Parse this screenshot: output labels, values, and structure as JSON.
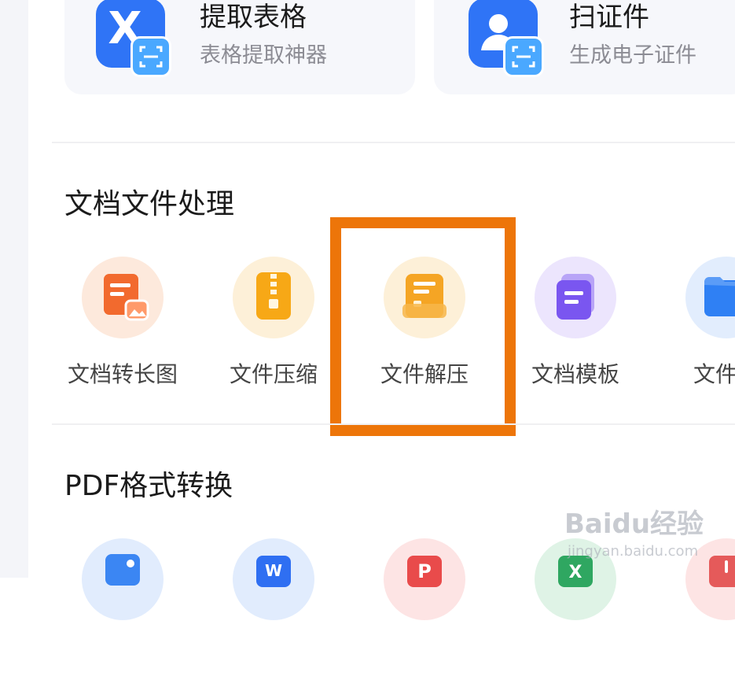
{
  "top_cards": [
    {
      "title": "提取表格",
      "subtitle": "表格提取神器",
      "icon": "table-extract-icon",
      "glyph": "X"
    },
    {
      "title": "扫证件",
      "subtitle": "生成电子证件",
      "icon": "id-card-scan-icon"
    }
  ],
  "sections": [
    {
      "title": "文档文件处理",
      "tools": [
        {
          "label": "文档转长图",
          "icon": "doc-to-long-image-icon",
          "color": "#f26a2e"
        },
        {
          "label": "文件压缩",
          "icon": "zip-compress-icon",
          "color": "#f7a816"
        },
        {
          "label": "文件解压",
          "icon": "unzip-icon",
          "color": "#f5a524"
        },
        {
          "label": "文档模板",
          "icon": "doc-template-icon",
          "color": "#7a56f0"
        },
        {
          "label": "文件目",
          "icon": "folder-icon",
          "color": "#2f80f4"
        }
      ]
    },
    {
      "title": "PDF格式转换",
      "tools": [
        {
          "icon": "pdf-to-image-icon",
          "color": "#3b86f3"
        },
        {
          "icon": "pdf-to-word-icon",
          "color": "#2f6ff2",
          "glyph": "W"
        },
        {
          "icon": "pdf-icon",
          "color": "#e94b4b",
          "glyph": "P"
        },
        {
          "icon": "pdf-to-excel-icon",
          "color": "#2fa761",
          "glyph": "X"
        },
        {
          "icon": "pdf-tool-icon",
          "color": "#e55a5a"
        }
      ]
    }
  ],
  "highlight_color": "#ed7509",
  "watermark": {
    "logo": "Baidu经验",
    "url": "jingyan.baidu.com"
  }
}
